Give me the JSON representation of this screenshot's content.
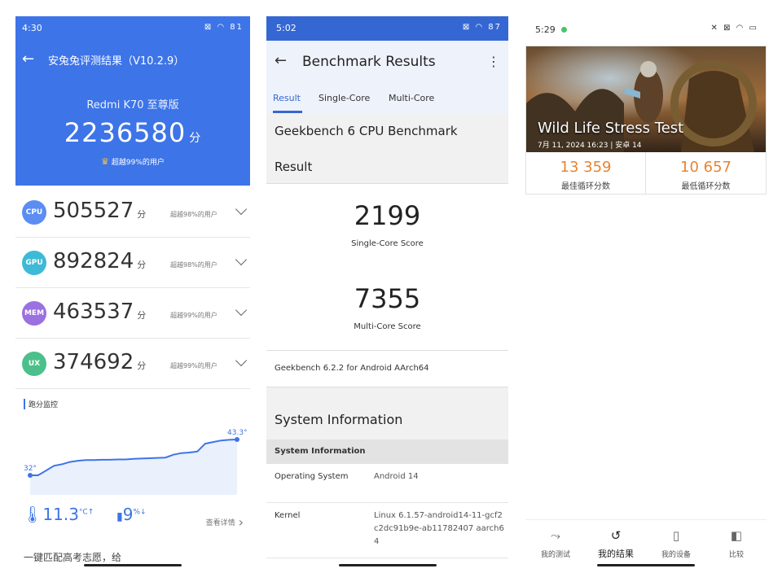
{
  "antutu": {
    "time": "4:30",
    "status_icons": "⊠ ◠ 81",
    "title": "安兔兔评测结果（V10.2.9）",
    "device": "Redmi K70 至尊版",
    "total_score": "2236580",
    "unit": "分",
    "rank": "超越99%的用户",
    "rows": [
      {
        "badge": "CPU",
        "color": "#5b8df2",
        "score": "505527",
        "rank": "超越98%的用户"
      },
      {
        "badge": "GPU",
        "color": "#3dbad6",
        "score": "892824",
        "rank": "超越98%的用户"
      },
      {
        "badge": "MEM",
        "color": "#9b70e0",
        "score": "463537",
        "rank": "超越99%的用户"
      },
      {
        "badge": "UX",
        "color": "#4cc08a",
        "score": "374692",
        "rank": "超越99%的用户"
      }
    ],
    "monitor_title": "跑分监控",
    "temp_start": "32°",
    "temp_end": "43.3°",
    "temp_rise": "11.3",
    "temp_unit": "°C↑",
    "battery_drop": "9",
    "battery_unit": "%↓",
    "detail": "查看详情",
    "cut_text": "一键匹配高考志愿，给",
    "temp_series": [
      32,
      32,
      33.5,
      35,
      35.5,
      36.2,
      36.6,
      36.8,
      36.8,
      36.9,
      36.9,
      37,
      37,
      37.2,
      37.3,
      37.4,
      37.5,
      37.6,
      38.5,
      39,
      39.2,
      39.5,
      42,
      42.5,
      43,
      43.2,
      43.3
    ]
  },
  "geekbench": {
    "time": "5:02",
    "status_icons": "⊠ ◠ 87",
    "title": "Benchmark Results",
    "tabs": [
      "Result",
      "Single-Core",
      "Multi-Core"
    ],
    "heading": "Geekbench 6 CPU Benchmark",
    "result_label": "Result",
    "single_score": "2199",
    "single_label": "Single-Core Score",
    "multi_score": "7355",
    "multi_label": "Multi-Core Score",
    "version": "Geekbench 6.2.2 for Android AArch64",
    "sys_title": "System Information",
    "sys_header": "System Information",
    "info": [
      {
        "key": "Operating System",
        "value": "Android 14"
      },
      {
        "key": "Kernel",
        "value": "Linux 6.1.57-android14-11-gcf2c2dc91b9e-ab11782407 aarch64"
      }
    ]
  },
  "threedmark": {
    "time": "5:29",
    "status_icons": "✕ ⊠ ◠ ▭",
    "test_name": "Wild Life Stress Test",
    "date": "7月 11, 2024 16:23 | 安卓 14",
    "best_value": "13 359",
    "best_label": "最佳循环分数",
    "worst_value": "10 657",
    "worst_label": "最低循环分数",
    "nav": [
      {
        "label": "我的测试",
        "icon": "⤳"
      },
      {
        "label": "我的结果",
        "icon": "↺"
      },
      {
        "label": "我的设备",
        "icon": "▯"
      },
      {
        "label": "比较",
        "icon": "◧"
      }
    ]
  }
}
